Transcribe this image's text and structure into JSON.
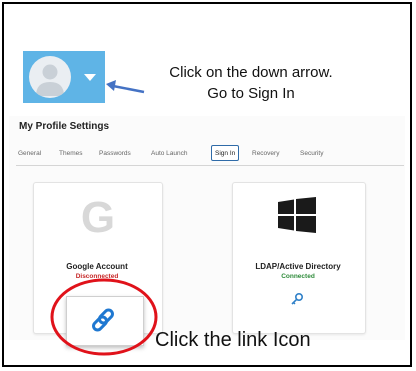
{
  "annotation": {
    "instruction_line1": "Click on the down arrow.",
    "instruction_line2": "Go to Sign In",
    "link_caption": "Click the link Icon",
    "highlight_color": "#e0121a",
    "arrow_color": "#4472c4"
  },
  "avatar": {
    "icon": "user-avatar-icon",
    "dropdown_icon": "caret-down-icon",
    "tile_color": "#5fb4e6"
  },
  "settings": {
    "title": "My Profile Settings",
    "tabs": [
      {
        "label": "General"
      },
      {
        "label": "Themes"
      },
      {
        "label": "Passwords"
      },
      {
        "label": "Auto Launch"
      },
      {
        "label": "Sign In",
        "active": true
      },
      {
        "label": "Recovery"
      },
      {
        "label": "Security"
      }
    ],
    "cards": [
      {
        "name": "Google Account",
        "status": "Disconnected",
        "status_color": "#c62828",
        "icon": "google-g-icon",
        "action_icon": "link-icon"
      },
      {
        "name": "LDAP/Active Directory",
        "status": "Connected",
        "status_color": "#2e8b3a",
        "icon": "windows-logo-icon",
        "action_icon": "key-icon"
      }
    ]
  }
}
